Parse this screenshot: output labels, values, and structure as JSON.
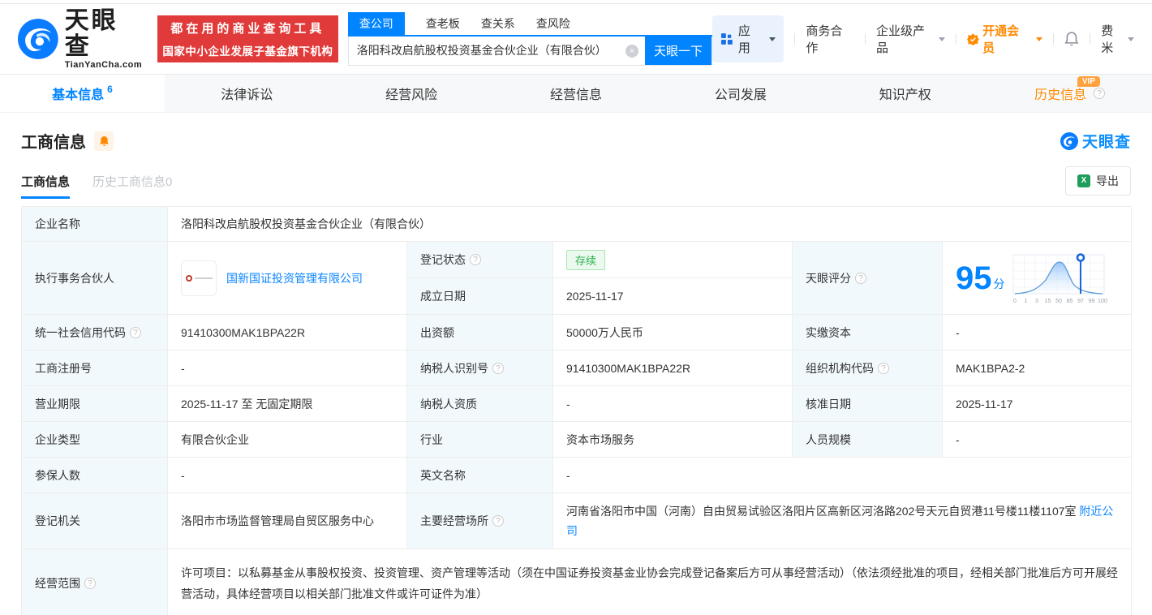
{
  "header": {
    "logo": {
      "brand": "天眼查",
      "domain": "TianYanCha.com"
    },
    "banner": {
      "line1": "都在用的商业查询工具",
      "line2": "国家中小企业发展子基金旗下机构"
    },
    "search": {
      "tabs": [
        {
          "label": "查公司",
          "active": true
        },
        {
          "label": "查老板",
          "active": false
        },
        {
          "label": "查关系",
          "active": false
        },
        {
          "label": "查风险",
          "active": false
        }
      ],
      "value": "洛阳科改启航股权投资基金合伙企业（有限合伙）",
      "button": "天眼一下"
    },
    "nav": {
      "apps": "应用",
      "cooperation": "商务合作",
      "enterprise": "企业级产品",
      "vip": "开通会员",
      "user": "费米"
    }
  },
  "main_tabs": [
    {
      "label": "基本信息",
      "count": "6",
      "active": true
    },
    {
      "label": "法律诉讼"
    },
    {
      "label": "经营风险"
    },
    {
      "label": "经营信息"
    },
    {
      "label": "公司发展"
    },
    {
      "label": "知识产权"
    },
    {
      "label": "历史信息",
      "badge": "VIP"
    }
  ],
  "section": {
    "title": "工商信息",
    "watermark": "天眼查",
    "subtabs": [
      {
        "label": "工商信息",
        "active": true
      },
      {
        "label": "历史工商信息0",
        "active": false
      }
    ],
    "export_label": "导出"
  },
  "table": {
    "company_name": {
      "label": "企业名称",
      "value": "洛阳科改启航股权投资基金合伙企业（有限合伙）"
    },
    "partner": {
      "label": "执行事务合伙人",
      "value": "国新国证投资管理有限公司"
    },
    "reg_status": {
      "label": "登记状态",
      "value": "存续"
    },
    "establish_date": {
      "label": "成立日期",
      "value": "2025-11-17"
    },
    "score": {
      "label": "天眼评分",
      "value": "95",
      "unit": "分"
    },
    "credit_code": {
      "label": "统一社会信用代码",
      "value": "91410300MAK1BPA22R"
    },
    "contribution": {
      "label": "出资额",
      "value": "50000万人民币"
    },
    "paid_capital": {
      "label": "实缴资本",
      "value": "-"
    },
    "reg_number": {
      "label": "工商注册号",
      "value": "-"
    },
    "taxpayer_id": {
      "label": "纳税人识别号",
      "value": "91410300MAK1BPA22R"
    },
    "org_code": {
      "label": "组织机构代码",
      "value": "MAK1BPA2-2"
    },
    "business_term": {
      "label": "营业期限",
      "value": "2025-11-17 至 无固定期限"
    },
    "taxpayer_qualification": {
      "label": "纳税人资质",
      "value": "-"
    },
    "approval_date": {
      "label": "核准日期",
      "value": "2025-11-17"
    },
    "company_type": {
      "label": "企业类型",
      "value": "有限合伙企业"
    },
    "industry": {
      "label": "行业",
      "value": "资本市场服务"
    },
    "staff_size": {
      "label": "人员规模",
      "value": "-"
    },
    "insured_count": {
      "label": "参保人数",
      "value": "-"
    },
    "english_name": {
      "label": "英文名称",
      "value": "-"
    },
    "registry": {
      "label": "登记机关",
      "value": "洛阳市市场监督管理局自贸区服务中心"
    },
    "premises": {
      "label": "主要经营场所",
      "value": "河南省洛阳市中国（河南）自由贸易试验区洛阳片区高新区河洛路202号天元自贸港11号楼11楼1107室",
      "link": "附近公司"
    },
    "business_scope": {
      "label": "经营范围",
      "value": "许可项目：以私募基金从事股权投资、投资管理、资产管理等活动（须在中国证券投资基金业协会完成登记备案后方可从事经营活动）（依法须经批准的项目，经相关部门批准后方可开展经营活动，具体经营项目以相关部门批准文件或许可证件为准）"
    }
  },
  "score_chart": {
    "type": "area",
    "score": 95,
    "marker_at_tick": "97",
    "ticks": [
      "0",
      "1",
      "3",
      "15",
      "50",
      "85",
      "97",
      "99",
      "100"
    ]
  },
  "icons": {
    "question": "?",
    "clear": "×",
    "excel": "X"
  },
  "colors": {
    "brand_blue": "#0084ff",
    "banner_red": "#e03b3a",
    "vip_orange": "#ff8a00",
    "status_green": "#2bb24c"
  }
}
